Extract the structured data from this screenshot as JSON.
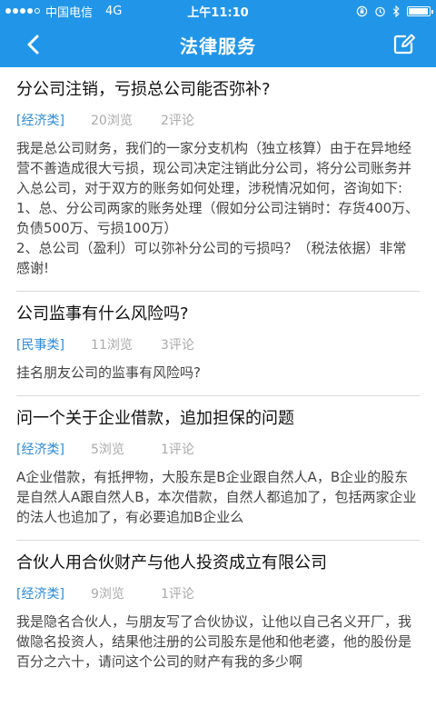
{
  "status_bar": {
    "carrier": "中国电信",
    "network": "4G",
    "time": "上午11:10",
    "battery_level": 0.95
  },
  "navbar": {
    "title": "法律服务",
    "back_icon": "chevron-left-icon",
    "edit_icon": "edit-icon"
  },
  "colors": {
    "primary": "#2196e9",
    "category": "#2d8bd8",
    "muted": "#aaaaaa",
    "divider": "#d9d9d9"
  },
  "posts": [
    {
      "title": "分公司注销，亏损总公司能否弥补?",
      "category": "[经济类]",
      "views": "20浏览",
      "comments": "2评论",
      "body_lines": [
        "我是总公司财务，我们的一家分支机构（独立核算）由于在异地经营不善造成很大亏损，现公司决定注销此分公司，将分公司账务并入总公司，对于双方的账务如何处理，涉税情况如何，咨询如下:",
        "1、总、分公司两家的账务处理（假如分公司注销时：存货400万、负债500万、亏损100万）",
        "2、总公司（盈利）可以弥补分公司的亏损吗？（税法依据）非常感谢!"
      ]
    },
    {
      "title": "公司监事有什么风险吗?",
      "category": "[民事类]",
      "views": "11浏览",
      "comments": "3评论",
      "body_lines": [
        "挂名朋友公司的监事有风险吗?"
      ]
    },
    {
      "title": "问一个关于企业借款，追加担保的问题",
      "category": "[经济类]",
      "views": "5浏览",
      "comments": "1评论",
      "body_lines": [
        "A企业借款，有抵押物，大股东是B企业跟自然人A，B企业的股东是自然人A跟自然人B，本次借款，自然人都追加了，包括两家企业的法人也追加了，有必要追加B企业么"
      ]
    },
    {
      "title": "合伙人用合伙财产与他人投资成立有限公司",
      "category": "[经济类]",
      "views": "9浏览",
      "comments": "1评论",
      "body_lines": [
        "我是隐名合伙人，与朋友写了合伙协议，让他以自己名义开厂，我做隐名投资人，结果他注册的公司股东是他和他老婆，他的股份是百分之六十，请问这个公司的财产有我的多少啊"
      ]
    }
  ]
}
